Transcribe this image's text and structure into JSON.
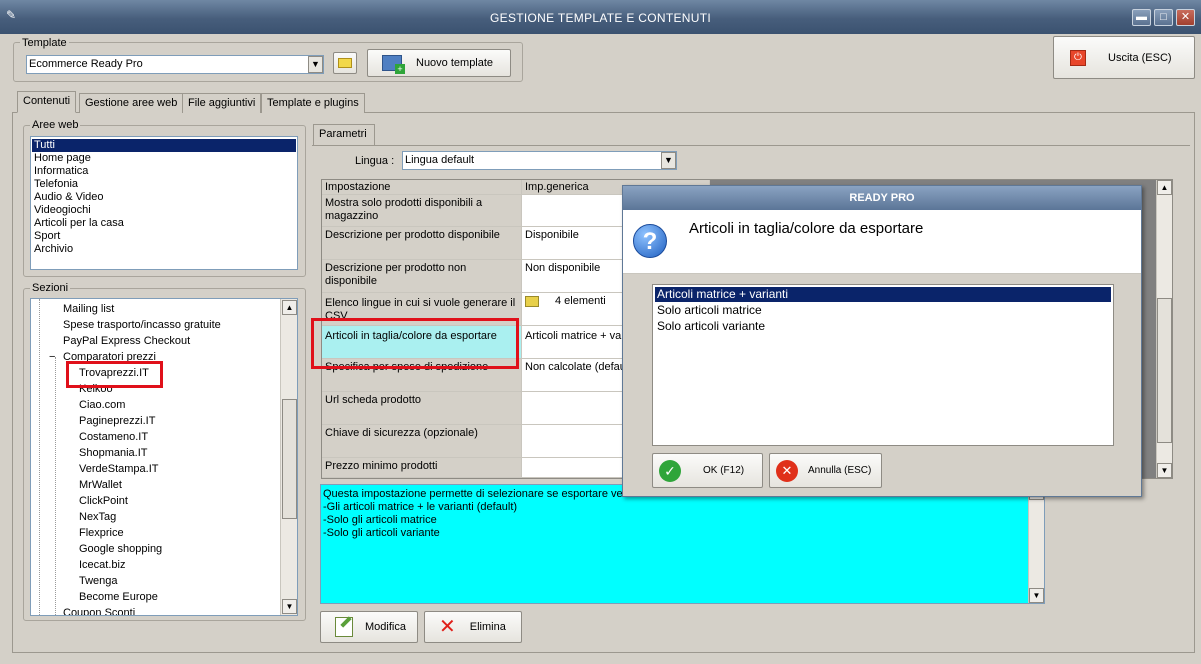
{
  "window": {
    "title": "GESTIONE TEMPLATE E CONTENUTI",
    "minimize": "▬",
    "maximize": "□",
    "close": "✕"
  },
  "template": {
    "group_label": "Template",
    "selected": "Ecommerce Ready Pro",
    "new_button": "Nuovo template"
  },
  "exit_button": "Uscita (ESC)",
  "tabs": [
    "Contenuti",
    "Gestione aree web",
    "File aggiuntivi",
    "Template e plugins"
  ],
  "aree_web": {
    "label": "Aree web",
    "items": [
      "Tutti",
      "Home page",
      "Informatica",
      "Telefonia",
      "Audio & Video",
      "Videogiochi",
      "Articoli per la casa",
      "Sport",
      "Archivio"
    ],
    "selected_index": 0
  },
  "sezioni": {
    "label": "Sezioni",
    "items": [
      "Mailing list",
      "Spese trasporto/incasso gratuite",
      "PayPal Express Checkout",
      "Comparatori prezzi",
      "Trovaprezzi.IT",
      "Kelkoo",
      "Ciao.com",
      "Pagineprezzi.IT",
      "Costameno.IT",
      "Shopmania.IT",
      "VerdeStampa.IT",
      "MrWallet",
      "ClickPoint",
      "NexTag",
      "Flexprice",
      "Google shopping",
      "Icecat.biz",
      "Twenga",
      "Become Europe",
      "Coupon Sconti"
    ],
    "expander": "−"
  },
  "params": {
    "tab_label": "Parametri",
    "lingua_label": "Lingua :",
    "lingua_value": "Lingua default",
    "columns": [
      "Impostazione",
      "Imp.generica"
    ],
    "rows": [
      {
        "setting": "Mostra solo prodotti disponibili a magazzino",
        "value": ""
      },
      {
        "setting": "Descrizione per prodotto disponibile",
        "value": "Disponibile"
      },
      {
        "setting": "Descrizione per prodotto non disponibile",
        "value": "Non disponibile"
      },
      {
        "setting": "Elenco lingue in cui si vuole generare il CSV",
        "value": "4 elementi"
      },
      {
        "setting": "Articoli in taglia/colore da esportare",
        "value": "Articoli matrice + var"
      },
      {
        "setting": "Specifica per spese di spedizione",
        "value": "Non calcolate (defau"
      },
      {
        "setting": "Url scheda prodotto",
        "value": ""
      },
      {
        "setting": "Chiave di sicurezza (opzionale)",
        "value": ""
      },
      {
        "setting": "Prezzo minimo prodotti",
        "value": ""
      }
    ],
    "description": [
      "Questa impostazione permette di selezionare se esportare ver",
      "-Gli articoli matrice + le varianti (default)",
      "-Solo gli articoli matrice",
      "-Solo gli articoli variante"
    ],
    "modify_button": "Modifica",
    "delete_button": "Elimina"
  },
  "dialog": {
    "title": "READY PRO",
    "question": "Articoli in taglia/colore da esportare",
    "options": [
      "Articoli matrice + varianti",
      "Solo articoli matrice",
      "Solo articoli variante"
    ],
    "selected_index": 0,
    "ok_button": "OK (F12)",
    "cancel_button": "Annulla (ESC)"
  },
  "colors": {
    "titlebar": "#4a6384",
    "selection": "#0a246a",
    "highlight_row": "#aaf0f0",
    "description_bg": "#00ffff",
    "callout": "#e0101a"
  }
}
